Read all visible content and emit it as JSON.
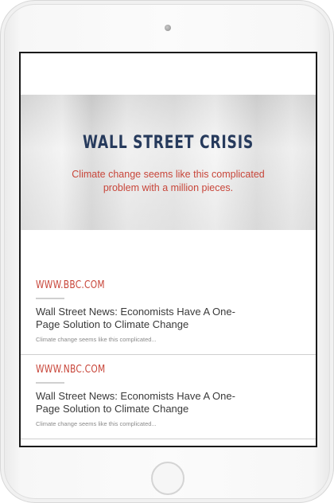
{
  "hero": {
    "title": "WALL STREET CRISIS",
    "subtitle": "Climate change seems like this complicated problem with a million pieces."
  },
  "articles": [
    {
      "source": "WWW.BBC.COM",
      "headline": "Wall Street News: Economists Have A One-Page Solution to Climate Change",
      "snippet": "Climate change seems like this complicated..."
    },
    {
      "source": "WWW.NBC.COM",
      "headline": "Wall Street News: Economists Have A One-Page Solution to Climate Change",
      "snippet": "Climate change seems like this complicated..."
    }
  ],
  "colors": {
    "accent": "#c8463a",
    "title": "#263a5c"
  }
}
